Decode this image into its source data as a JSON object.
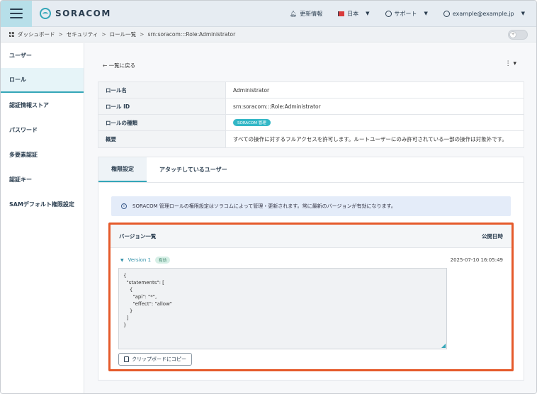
{
  "header": {
    "logo_text": "SORACOM",
    "news": "更新情報",
    "language": "日本",
    "support": "サポート",
    "account": "example@example.jp"
  },
  "breadcrumb": [
    "ダッシュボード",
    "セキュリティ",
    "ロール一覧",
    "srn:soracom:::Role:Administrator"
  ],
  "sidebar": {
    "items": [
      {
        "label": "ユーザー"
      },
      {
        "label": "ロール"
      },
      {
        "label": "認証情報ストア"
      },
      {
        "label": "パスワード"
      },
      {
        "label": "多要素認証"
      },
      {
        "label": "認証キー"
      },
      {
        "label": "SAMデフォルト権限設定"
      }
    ]
  },
  "main": {
    "back_label": "← 一覧に戻る",
    "kebab": "⋮ ▾",
    "info": {
      "name_key": "ロール名",
      "name_val": "Administrator",
      "id_key": "ロール ID",
      "id_val": "srn:soracom:::Role:Administrator",
      "type_key": "ロールの種類",
      "type_badge": "SORACOM 管理",
      "desc_key": "概要",
      "desc_val": "すべての操作に対するフルアクセスを許可します。ルートユーザーにのみ許可されている一部の操作は対象外です。"
    },
    "tabs": [
      {
        "label": "権限設定"
      },
      {
        "label": "アタッチしているユーザー"
      }
    ],
    "notice": "SORACOM 管理ロールの権限設定はソラコムによって管理・更新されます。常に最新のバージョンが有効になります。",
    "versions": {
      "header_left": "バージョン一覧",
      "header_right": "公開日時",
      "version_label": "Version 1",
      "version_badge": "有効",
      "date": "2025-07-10 16:05:49",
      "code": "{\n  \"statements\": [\n    {\n      \"api\": \"*\",\n      \"effect\": \"allow\"\n    }\n  ]\n}",
      "copy_label": "クリップボードにコピー"
    }
  }
}
